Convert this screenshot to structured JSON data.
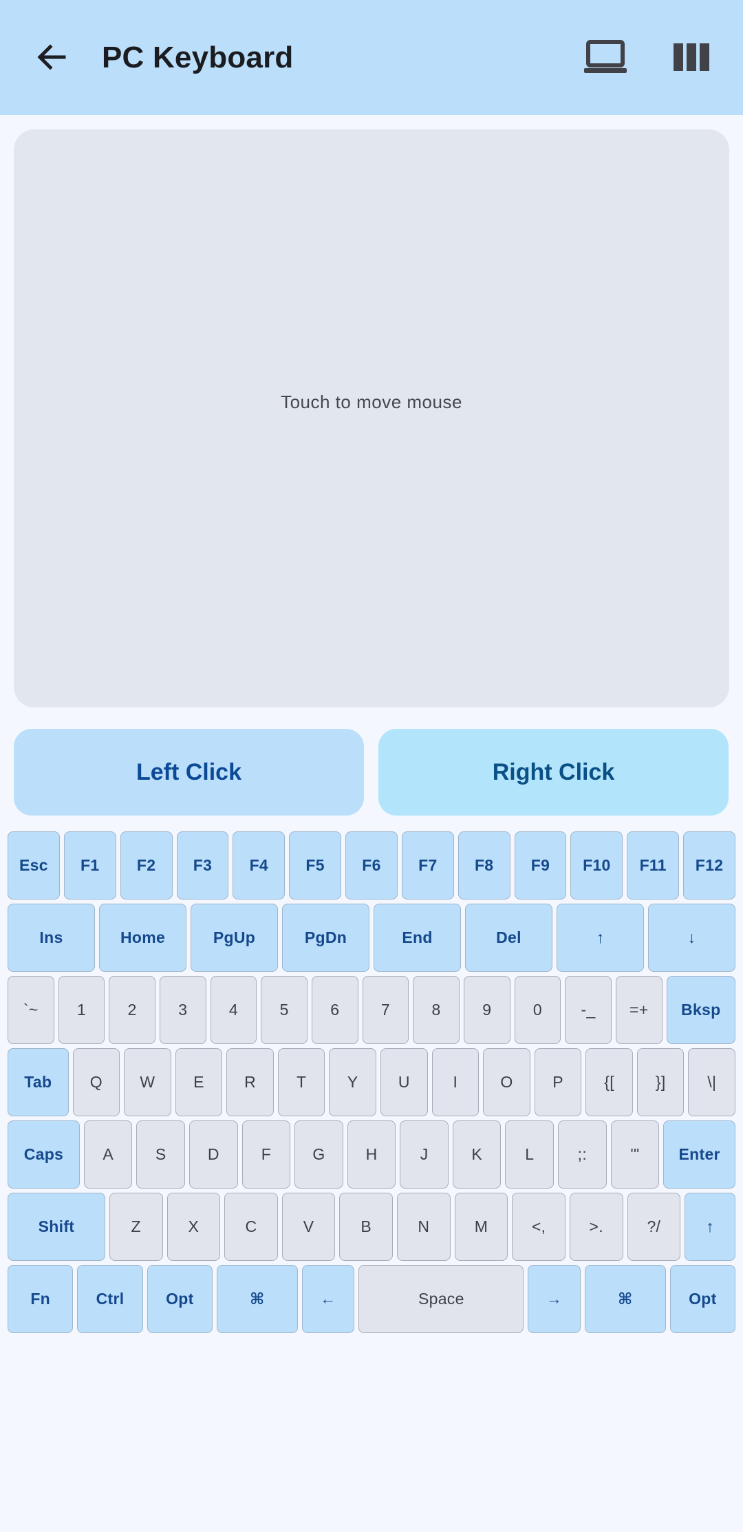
{
  "appbar": {
    "title": "PC Keyboard",
    "back_icon": "arrow-left-icon",
    "device_icon": "laptop-icon",
    "layout_icon": "columns-icon",
    "background": "#bbdefa"
  },
  "touchpad": {
    "hint": "Touch to move mouse"
  },
  "mouse_buttons": {
    "left": "Left Click",
    "right": "Right Click"
  },
  "keyboard": {
    "rows": [
      [
        {
          "label": "Esc",
          "mod": true
        },
        {
          "label": "F1",
          "mod": true
        },
        {
          "label": "F2",
          "mod": true
        },
        {
          "label": "F3",
          "mod": true
        },
        {
          "label": "F4",
          "mod": true
        },
        {
          "label": "F5",
          "mod": true
        },
        {
          "label": "F6",
          "mod": true
        },
        {
          "label": "F7",
          "mod": true
        },
        {
          "label": "F8",
          "mod": true
        },
        {
          "label": "F9",
          "mod": true
        },
        {
          "label": "F10",
          "mod": true
        },
        {
          "label": "F11",
          "mod": true
        },
        {
          "label": "F12",
          "mod": true
        }
      ],
      [
        {
          "label": "Ins",
          "mod": true
        },
        {
          "label": "Home",
          "mod": true
        },
        {
          "label": "PgUp",
          "mod": true
        },
        {
          "label": "PgDn",
          "mod": true
        },
        {
          "label": "End",
          "mod": true
        },
        {
          "label": "Del",
          "mod": true
        },
        {
          "label": "↑",
          "mod": true
        },
        {
          "label": "↓",
          "mod": true
        }
      ],
      [
        {
          "label": "`~"
        },
        {
          "label": "1"
        },
        {
          "label": "2"
        },
        {
          "label": "3"
        },
        {
          "label": "4"
        },
        {
          "label": "5"
        },
        {
          "label": "6"
        },
        {
          "label": "7"
        },
        {
          "label": "8"
        },
        {
          "label": "9"
        },
        {
          "label": "0"
        },
        {
          "label": "-_"
        },
        {
          "label": "=+"
        },
        {
          "label": "Bksp",
          "mod": true,
          "grow": 1.5
        }
      ],
      [
        {
          "label": "Tab",
          "mod": true,
          "grow": 1.3
        },
        {
          "label": "Q"
        },
        {
          "label": "W"
        },
        {
          "label": "E"
        },
        {
          "label": "R"
        },
        {
          "label": "T"
        },
        {
          "label": "Y"
        },
        {
          "label": "U"
        },
        {
          "label": "I"
        },
        {
          "label": "O"
        },
        {
          "label": "P"
        },
        {
          "label": "{["
        },
        {
          "label": "}]"
        },
        {
          "label": "\\|"
        }
      ],
      [
        {
          "label": "Caps",
          "mod": true,
          "grow": 1.5
        },
        {
          "label": "A"
        },
        {
          "label": "S"
        },
        {
          "label": "D"
        },
        {
          "label": "F"
        },
        {
          "label": "G"
        },
        {
          "label": "H"
        },
        {
          "label": "J"
        },
        {
          "label": "K"
        },
        {
          "label": "L"
        },
        {
          "label": ";:"
        },
        {
          "label": "'\""
        },
        {
          "label": "Enter",
          "mod": true,
          "grow": 1.5
        }
      ],
      [
        {
          "label": "Shift",
          "mod": true,
          "grow": 1.85
        },
        {
          "label": "Z"
        },
        {
          "label": "X"
        },
        {
          "label": "C"
        },
        {
          "label": "V"
        },
        {
          "label": "B"
        },
        {
          "label": "N"
        },
        {
          "label": "M"
        },
        {
          "label": "<,"
        },
        {
          "label": ">."
        },
        {
          "label": "?/"
        },
        {
          "label": "↑",
          "mod": true,
          "plain": true,
          "grow": 0.95
        }
      ],
      [
        {
          "label": "Fn",
          "mod": true
        },
        {
          "label": "Ctrl",
          "mod": true
        },
        {
          "label": "Opt",
          "mod": true
        },
        {
          "label": "⌘",
          "mod": true,
          "grow": 1.24
        },
        {
          "label": "←",
          "mod": true,
          "plain": true,
          "grow": 0.8
        },
        {
          "label": "Space",
          "grow": 2.55
        },
        {
          "label": "→",
          "mod": true,
          "plain": true,
          "grow": 0.8
        },
        {
          "label": "⌘",
          "mod": true,
          "grow": 1.24
        },
        {
          "label": "Opt",
          "mod": true
        }
      ]
    ]
  }
}
